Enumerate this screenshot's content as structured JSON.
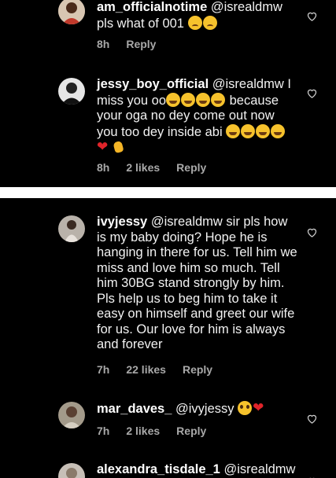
{
  "comments": [
    {
      "username": "am_officialnotime",
      "text": " @isrealdmw pls what of 001 ",
      "emoji": [
        "sad",
        "sad"
      ],
      "time": "8h",
      "likes": "",
      "reply": "Reply"
    },
    {
      "username": "jessy_boy_official",
      "text": " @isrealdmw I miss you oo",
      "text2": " because your oga no dey come out now you too dey inside abi ",
      "emoji_a": [
        "laugh",
        "laugh",
        "laugh",
        "laugh"
      ],
      "emoji_b": [
        "laugh",
        "laugh",
        "laugh",
        "laugh",
        "heart-e",
        "clap"
      ],
      "time": "8h",
      "likes": "2 likes",
      "reply": "Reply"
    },
    {
      "username": "ivyjessy",
      "text": " @isrealdmw sir pls how is my baby doing? Hope he is hanging in there for us. Tell him we miss and love him so much. Tell him 30BG stand strongly by him. Pls help us to beg him to take it easy on himself and greet our wife for us. Our love for him is always and forever",
      "time": "7h",
      "likes": "22 likes",
      "reply": "Reply"
    },
    {
      "username": "mar_daves_",
      "text": " @ivyjessy ",
      "emoji": [
        "plead",
        "heart-e"
      ],
      "time": "7h",
      "likes": "2 likes",
      "reply": "Reply"
    },
    {
      "username": "alexandra_tisdale_1",
      "text": " @isrealdmw",
      "time": "",
      "likes": "",
      "reply": ""
    }
  ],
  "colors": {
    "background": "#000000",
    "text": "#f2f2f2",
    "meta": "#a8a8a8",
    "separator": "#ffffff"
  },
  "icons": {
    "like": "heart-outline-icon"
  }
}
